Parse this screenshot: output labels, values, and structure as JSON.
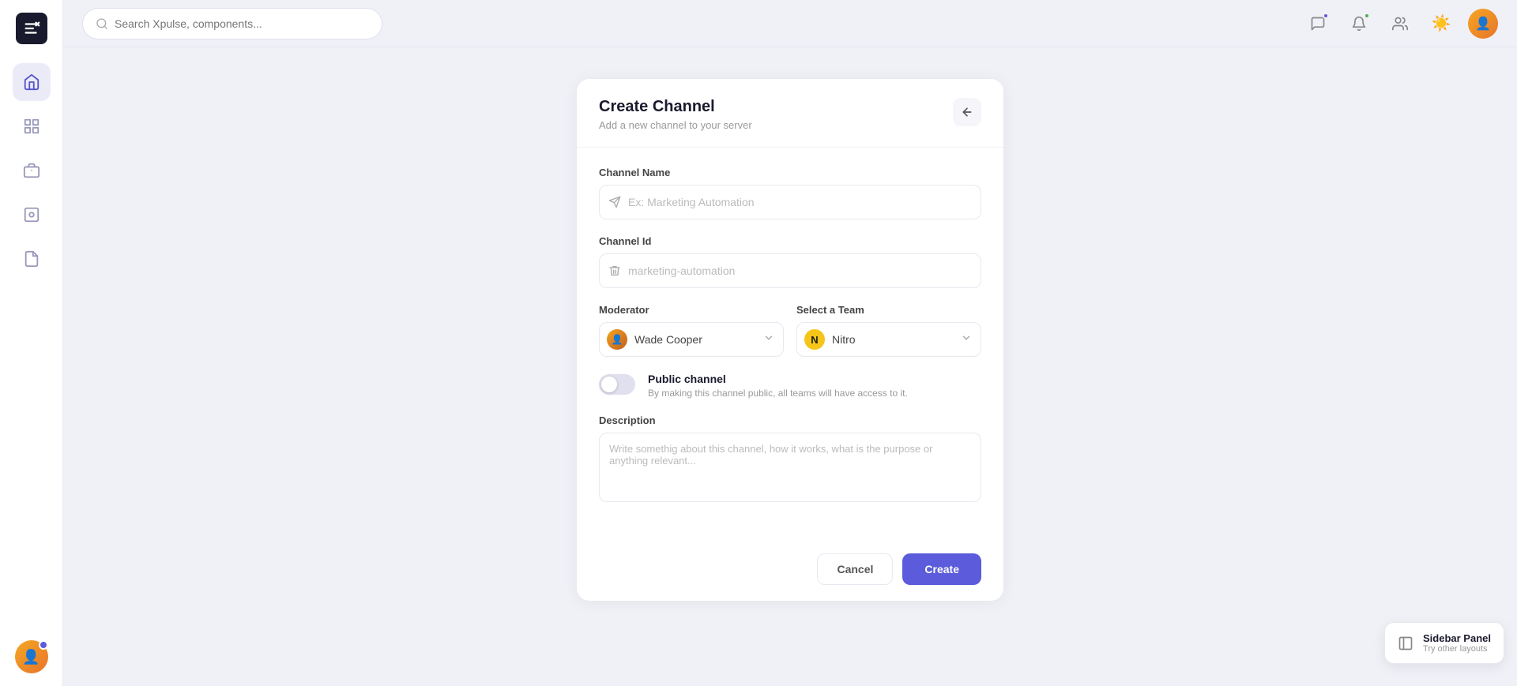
{
  "app": {
    "name": "Xpulse"
  },
  "topbar": {
    "search_placeholder": "Search Xpulse, components...",
    "sun_icon": "☀️"
  },
  "sidebar": {
    "items": [
      {
        "id": "dashboard",
        "label": "Dashboard",
        "active": true
      },
      {
        "id": "grid",
        "label": "Grid"
      },
      {
        "id": "briefcase",
        "label": "Briefcase"
      },
      {
        "id": "card",
        "label": "Card"
      },
      {
        "id": "note",
        "label": "Note"
      }
    ]
  },
  "create_channel": {
    "title": "Create Channel",
    "subtitle": "Add a new channel to your server",
    "channel_name_label": "Channel Name",
    "channel_name_placeholder": "Ex: Marketing Automation",
    "channel_id_label": "Channel Id",
    "channel_id_placeholder": "marketing-automation",
    "moderator_label": "Moderator",
    "moderator_value": "Wade Cooper",
    "team_label": "Select a Team",
    "team_value": "Nitro",
    "public_channel_title": "Public channel",
    "public_channel_desc": "By making this channel public, all teams will have access to it.",
    "description_label": "Description",
    "description_placeholder": "Write somethig about this channel, how it works, what is the purpose or anything relevant...",
    "cancel_label": "Cancel",
    "create_label": "Create"
  },
  "sidebar_panel": {
    "title": "Sidebar Panel",
    "subtitle": "Try other layouts"
  }
}
